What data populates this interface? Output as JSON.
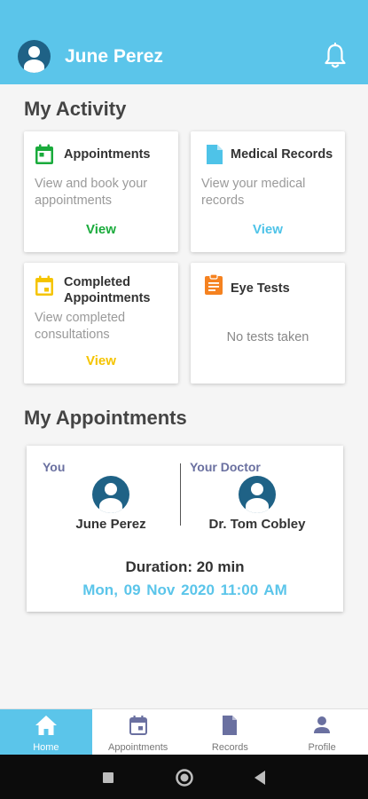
{
  "header": {
    "user_name": "June Perez",
    "background": "#5bc5ea",
    "avatar_icon": "user-avatar-icon",
    "notification_icon": "bell-icon"
  },
  "activity": {
    "title": "My Activity",
    "cards": [
      {
        "title": "Appointments",
        "description": "View and book your appointments",
        "link": "View",
        "icon": "calendar-icon",
        "color": "#1aab3c"
      },
      {
        "title": "Medical Records",
        "description": "View your medical records",
        "link": "View",
        "icon": "document-icon",
        "color": "#4ec3e8"
      },
      {
        "title_line1": "Completed",
        "title_line2": "Appointments",
        "description": "View completed consultations",
        "link": "View",
        "icon": "calendar-check-icon",
        "color": "#f5c400"
      },
      {
        "title": "Eye Tests",
        "empty_text": "No tests taken",
        "icon": "clipboard-icon",
        "color": "#f58220"
      }
    ]
  },
  "appointments": {
    "title": "My Appointments",
    "you_label": "You",
    "doctor_label": "Your Doctor",
    "patient_name": "June Perez",
    "doctor_name": "Dr. Tom Cobley",
    "duration": "Duration: 20 min",
    "datetime": "Mon, 09 Nov 2020  11:00 AM"
  },
  "tabs": [
    {
      "label": "Home",
      "icon": "home-icon",
      "active": true
    },
    {
      "label": "Appointments",
      "icon": "calendar-icon",
      "active": false
    },
    {
      "label": "Records",
      "icon": "document-icon",
      "active": false
    },
    {
      "label": "Profile",
      "icon": "person-icon",
      "active": false
    }
  ],
  "system_nav": [
    "recents-icon",
    "home-circle-icon",
    "back-icon"
  ]
}
